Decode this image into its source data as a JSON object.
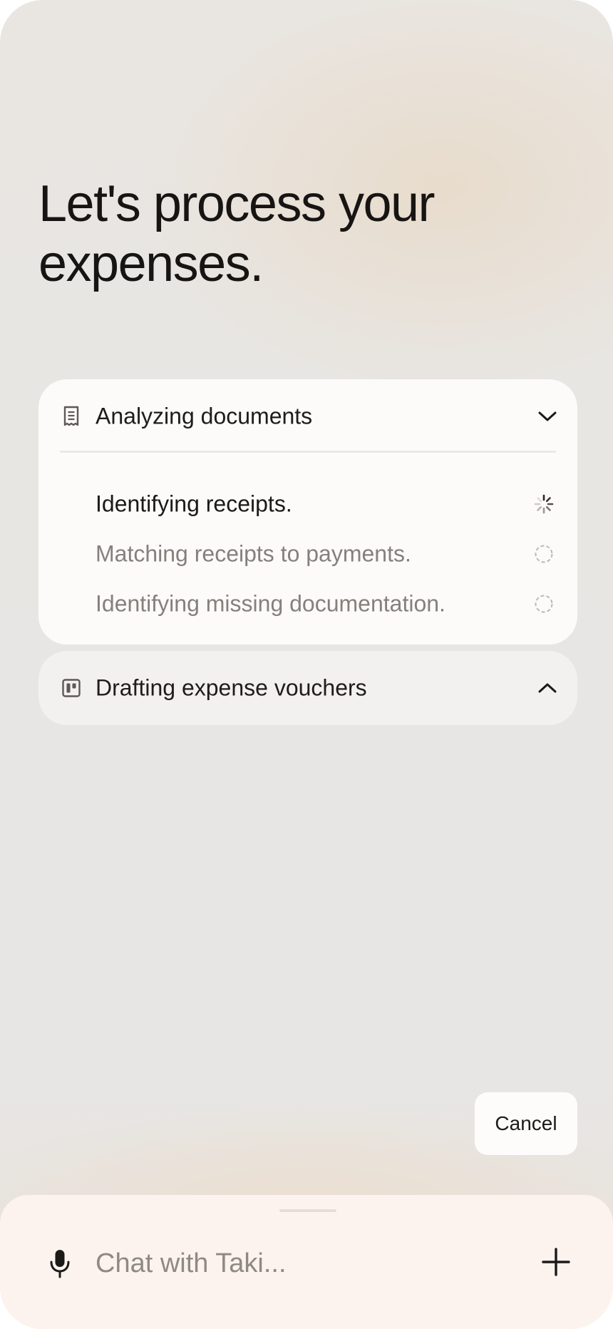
{
  "headline": "Let's process your expenses.",
  "tasks": [
    {
      "title": "Analyzing documents",
      "icon": "receipt-icon",
      "expanded": true,
      "toggle_icon": "chevron-down-icon",
      "steps": [
        {
          "label": "Identifying receipts.",
          "status": "in-progress",
          "status_icon": "spinner-icon"
        },
        {
          "label": "Matching receipts to payments.",
          "status": "pending",
          "status_icon": "dashed-circle-icon"
        },
        {
          "label": "Identifying missing documentation.",
          "status": "pending",
          "status_icon": "dashed-circle-icon"
        }
      ]
    },
    {
      "title": "Drafting expense vouchers",
      "icon": "voucher-icon",
      "expanded": false,
      "toggle_icon": "chevron-up-icon"
    }
  ],
  "cancel_label": "Cancel",
  "composer": {
    "placeholder": "Chat with Taki...",
    "mic_icon": "microphone-icon",
    "add_icon": "plus-icon"
  },
  "colors": {
    "text_primary": "#1c1a18",
    "text_muted": "#85807b",
    "card_bg": "#fcfbfa",
    "card_collapsed_bg": "#f3f1ef",
    "composer_bg": "#fcf3ee"
  }
}
